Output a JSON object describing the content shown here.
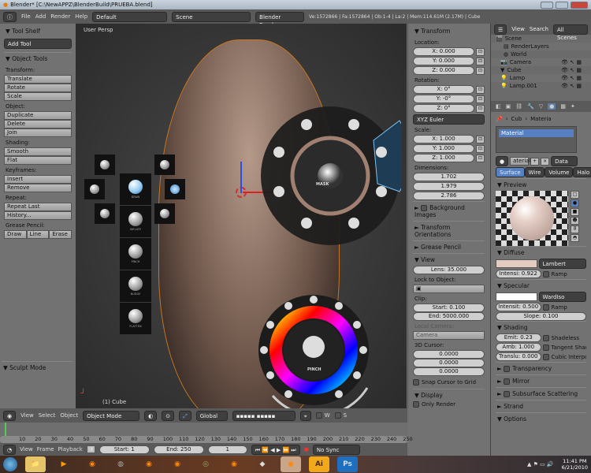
{
  "window": {
    "title": "Blender* [C:\\NewAPPZ\\BlenderBuild\\PRUEBA.blend]"
  },
  "header": {
    "menus": [
      "File",
      "Add",
      "Render",
      "Help"
    ],
    "layout": "Default",
    "scene": "Scene",
    "engine": "Blender Render",
    "stats": "Ve:1572866 | Fa:1572864 | Ob:1-4 | La:2 | Mem:114.61M (2.17M) | Cube"
  },
  "toolshelf": {
    "title": "Tool Shelf",
    "add_tool": "Add Tool",
    "object_tools": "Object Tools",
    "groups": [
      {
        "label": "Transform:",
        "buttons": [
          "Translate",
          "Rotate",
          "Scale"
        ]
      },
      {
        "label": "Object:",
        "buttons": [
          "Duplicate",
          "Delete",
          "Join"
        ]
      },
      {
        "label": "Shading:",
        "buttons": [
          "Smooth",
          "Flat"
        ]
      },
      {
        "label": "Keyframes:",
        "buttons": [
          "Insert",
          "Remove"
        ]
      },
      {
        "label": "Repeat:",
        "buttons": [
          "Repeat Last",
          "History..."
        ]
      }
    ],
    "grease_label": "Grease Pencil:",
    "grease": [
      "Draw",
      "Line",
      "Erase"
    ],
    "sculpt_mode": "Sculpt Mode"
  },
  "viewport": {
    "view_name": "User Persp",
    "object_label": "(1) Cube",
    "brush_column": [
      "DRAW",
      "INFLATE",
      "PINCH",
      "NUDGE",
      "FLATTEN"
    ],
    "mask_label": "MASK",
    "pinch_label": "PINCH"
  },
  "npanel": {
    "transform": "Transform",
    "location": "Location:",
    "loc": [
      "X: 0.000",
      "Y: 0.000",
      "Z: 0.000"
    ],
    "rotation": "Rotation:",
    "rot": [
      "X: 0°",
      "Y: -0°",
      "Z: 0°"
    ],
    "rot_mode": "XYZ Euler",
    "scale": "Scale:",
    "scl": [
      "X: 1.000",
      "Y: 1.000",
      "Z: 1.000"
    ],
    "dimensions": "Dimensions:",
    "dims": [
      "1.702",
      "1.979",
      "2.786"
    ],
    "collapsed": [
      "Background Images",
      "Transform Orientations",
      "Grease Pencil"
    ],
    "view": "View",
    "lens": "Lens: 35.000",
    "lock_obj": "Lock to Object:",
    "clip": "Clip:",
    "clip_start": "Start: 0.100",
    "clip_end": "End: 5000.000",
    "local_camera": "Local Camera:",
    "camera": "Camera",
    "cursor": "3D Cursor:",
    "cursor_vals": [
      "0.0000",
      "0.0000",
      "0.0000"
    ],
    "snap": "Snap Cursor to Grid",
    "display": "Display",
    "only_render": "Only Render"
  },
  "outliner": {
    "menus": [
      "View",
      "Search",
      "All Scenes"
    ],
    "items": [
      "Scene",
      "RenderLayers",
      "World",
      "Camera",
      "Cube",
      "Lamp",
      "Lamp.001"
    ]
  },
  "properties": {
    "breadcrumb": [
      "Cub",
      "Materia"
    ],
    "material_slot": "Material",
    "mat_name": "aterial",
    "data": "Data",
    "tabs": [
      "Surface",
      "Wire",
      "Volume",
      "Halo"
    ],
    "preview": "Preview",
    "diffuse": "Diffuse",
    "diffuse_shader": "Lambert",
    "diffuse_intensity": "Intensi: 0.922",
    "ramp": "Ramp",
    "specular": "Specular",
    "spec_shader": "WardIso",
    "spec_intensity": "Intensit: 0.500",
    "slope": "Slope: 0.100",
    "shading": "Shading",
    "emit": "Emit: 0.23",
    "amb": "Amb: 1.000",
    "translu": "Translu: 0.000",
    "shadeless": "Shadeless",
    "tangent": "Tangent Shad",
    "cubic": "Cubic Interpo",
    "panels": [
      "Transparency",
      "Mirror",
      "Subsurface Scattering",
      "Strand",
      "Options"
    ],
    "diffuse_color": "#e3cbc2",
    "spec_color": "#ffffff"
  },
  "view_header": {
    "menus": [
      "View",
      "Select",
      "Object"
    ],
    "mode": "Object Mode",
    "orientation": "Global",
    "layers_w": "W",
    "layers_s": "S"
  },
  "timeline": {
    "ticks": [
      "10",
      "20",
      "30",
      "40",
      "50",
      "60",
      "70",
      "80",
      "90",
      "100",
      "110",
      "120",
      "130",
      "140",
      "150",
      "160",
      "170",
      "180",
      "190",
      "200",
      "210",
      "220",
      "230",
      "240",
      "250"
    ],
    "menus": [
      "View",
      "Frame",
      "Playback"
    ],
    "start": "Start: 1",
    "end": "End: 250",
    "current": "1",
    "sync": "No Sync"
  },
  "taskbar": {
    "time": "11:41 PM",
    "date": "6/21/2010",
    "ai": "Ai",
    "ps": "Ps"
  }
}
